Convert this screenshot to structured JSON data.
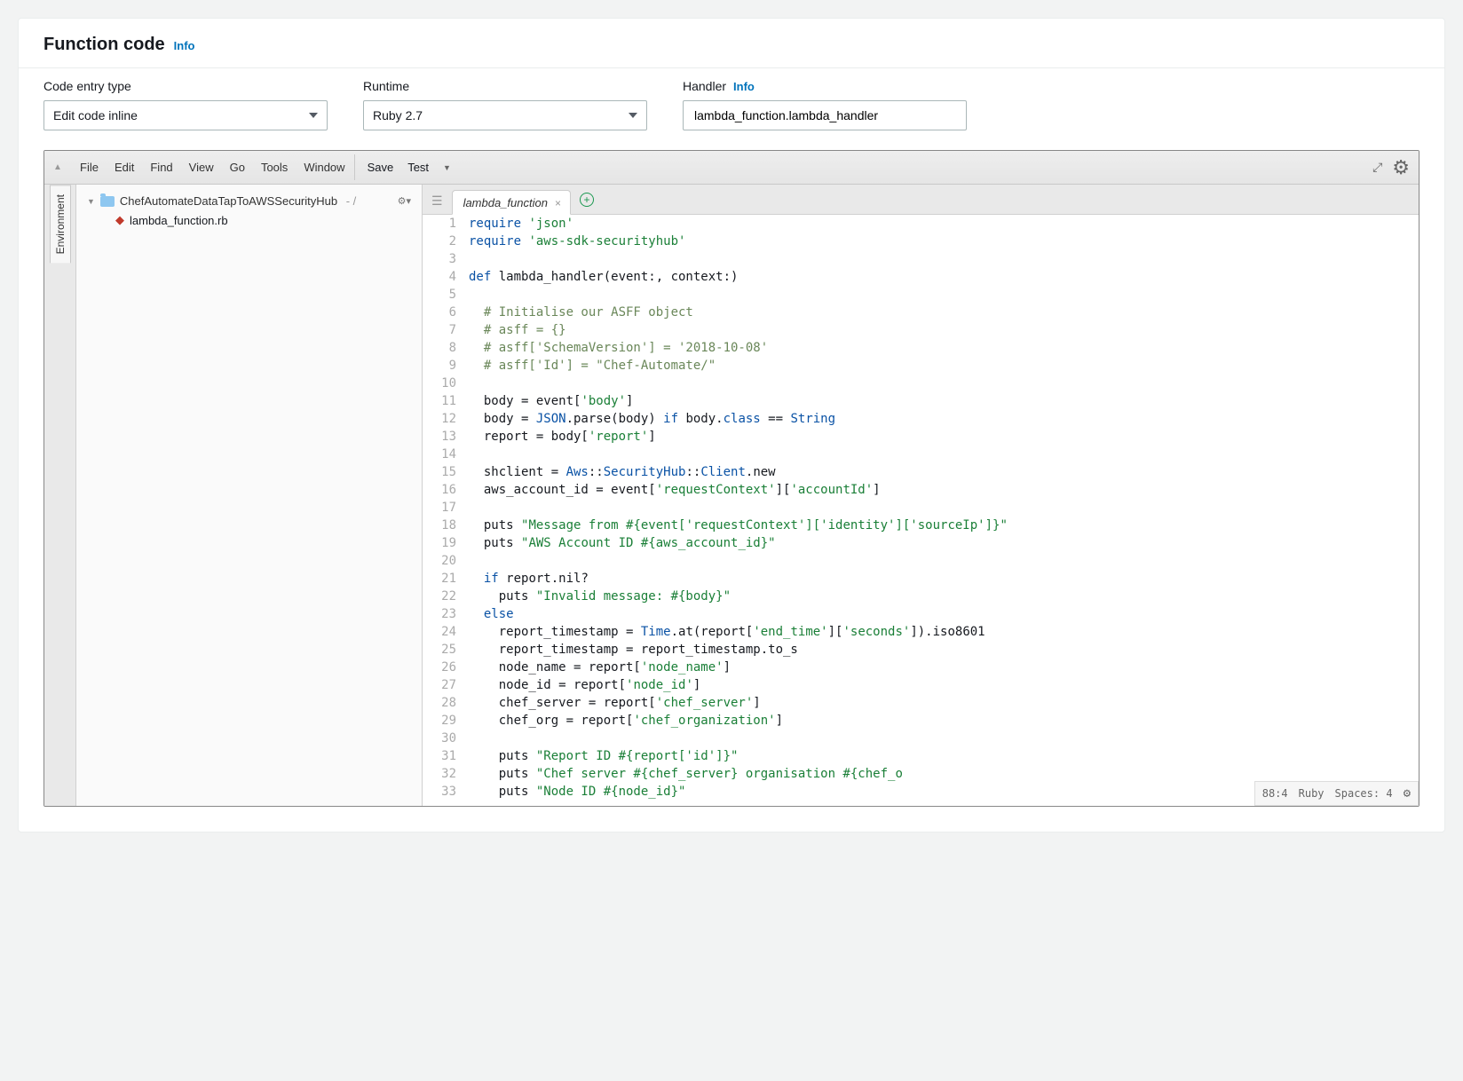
{
  "header": {
    "title": "Function code",
    "info": "Info"
  },
  "controls": {
    "codeEntry": {
      "label": "Code entry type",
      "value": "Edit code inline"
    },
    "runtime": {
      "label": "Runtime",
      "value": "Ruby 2.7"
    },
    "handler": {
      "label": "Handler",
      "info": "Info",
      "value": "lambda_function.lambda_handler"
    }
  },
  "ide": {
    "menus": [
      "File",
      "Edit",
      "Find",
      "View",
      "Go",
      "Tools",
      "Window"
    ],
    "actions": {
      "save": "Save",
      "test": "Test"
    },
    "sidebarTabLabel": "Environment",
    "tree": {
      "project": "ChefAutomateDataTapToAWSSecurityHub",
      "file": "lambda_function.rb"
    },
    "tab": "lambda_function",
    "statusBar": {
      "position": "88:4",
      "language": "Ruby",
      "spaces": "Spaces: 4"
    },
    "code": [
      {
        "n": 1,
        "tokens": [
          {
            "t": "require ",
            "c": "kw"
          },
          {
            "t": "'json'",
            "c": "str"
          }
        ]
      },
      {
        "n": 2,
        "tokens": [
          {
            "t": "require ",
            "c": "kw"
          },
          {
            "t": "'aws-sdk-securityhub'",
            "c": "str"
          }
        ]
      },
      {
        "n": 3,
        "tokens": [
          {
            "t": "",
            "c": ""
          }
        ]
      },
      {
        "n": 4,
        "tokens": [
          {
            "t": "def ",
            "c": "kw"
          },
          {
            "t": "lambda_handler(event:, context:)",
            "c": "fn"
          }
        ]
      },
      {
        "n": 5,
        "tokens": [
          {
            "t": "",
            "c": ""
          }
        ]
      },
      {
        "n": 6,
        "tokens": [
          {
            "t": "  # Initialise our ASFF object",
            "c": "com"
          }
        ]
      },
      {
        "n": 7,
        "tokens": [
          {
            "t": "  # asff = {}",
            "c": "com"
          }
        ]
      },
      {
        "n": 8,
        "tokens": [
          {
            "t": "  # asff['SchemaVersion'] = '2018-10-08'",
            "c": "com"
          }
        ]
      },
      {
        "n": 9,
        "tokens": [
          {
            "t": "  # asff['Id'] = \"Chef-Automate/\"",
            "c": "com"
          }
        ]
      },
      {
        "n": 10,
        "tokens": [
          {
            "t": "",
            "c": ""
          }
        ]
      },
      {
        "n": 11,
        "tokens": [
          {
            "t": "  body = event[",
            "c": ""
          },
          {
            "t": "'body'",
            "c": "str"
          },
          {
            "t": "]",
            "c": ""
          }
        ]
      },
      {
        "n": 12,
        "tokens": [
          {
            "t": "  body = ",
            "c": ""
          },
          {
            "t": "JSON",
            "c": "const"
          },
          {
            "t": ".parse(body) ",
            "c": ""
          },
          {
            "t": "if",
            "c": "kw"
          },
          {
            "t": " body.",
            "c": ""
          },
          {
            "t": "class",
            "c": "kw"
          },
          {
            "t": " == ",
            "c": ""
          },
          {
            "t": "String",
            "c": "const"
          }
        ]
      },
      {
        "n": 13,
        "tokens": [
          {
            "t": "  report = body[",
            "c": ""
          },
          {
            "t": "'report'",
            "c": "str"
          },
          {
            "t": "]",
            "c": ""
          }
        ]
      },
      {
        "n": 14,
        "tokens": [
          {
            "t": "",
            "c": ""
          }
        ]
      },
      {
        "n": 15,
        "tokens": [
          {
            "t": "  shclient = ",
            "c": ""
          },
          {
            "t": "Aws",
            "c": "const"
          },
          {
            "t": "::",
            "c": ""
          },
          {
            "t": "SecurityHub",
            "c": "const"
          },
          {
            "t": "::",
            "c": ""
          },
          {
            "t": "Client",
            "c": "const"
          },
          {
            "t": ".new",
            "c": ""
          }
        ]
      },
      {
        "n": 16,
        "tokens": [
          {
            "t": "  aws_account_id = event[",
            "c": ""
          },
          {
            "t": "'requestContext'",
            "c": "str"
          },
          {
            "t": "][",
            "c": ""
          },
          {
            "t": "'accountId'",
            "c": "str"
          },
          {
            "t": "]",
            "c": ""
          }
        ]
      },
      {
        "n": 17,
        "tokens": [
          {
            "t": "",
            "c": ""
          }
        ]
      },
      {
        "n": 18,
        "tokens": [
          {
            "t": "  puts ",
            "c": ""
          },
          {
            "t": "\"Message from #{event['requestContext']['identity']['sourceIp']}\"",
            "c": "str"
          }
        ]
      },
      {
        "n": 19,
        "tokens": [
          {
            "t": "  puts ",
            "c": ""
          },
          {
            "t": "\"AWS Account ID #{aws_account_id}\"",
            "c": "str"
          }
        ]
      },
      {
        "n": 20,
        "tokens": [
          {
            "t": "",
            "c": ""
          }
        ]
      },
      {
        "n": 21,
        "tokens": [
          {
            "t": "  if ",
            "c": "kw"
          },
          {
            "t": "report.nil?",
            "c": ""
          }
        ]
      },
      {
        "n": 22,
        "tokens": [
          {
            "t": "    puts ",
            "c": ""
          },
          {
            "t": "\"Invalid message: #{body}\"",
            "c": "str"
          }
        ]
      },
      {
        "n": 23,
        "tokens": [
          {
            "t": "  else",
            "c": "kw"
          }
        ]
      },
      {
        "n": 24,
        "tokens": [
          {
            "t": "    report_timestamp = ",
            "c": ""
          },
          {
            "t": "Time",
            "c": "const"
          },
          {
            "t": ".at(report[",
            "c": ""
          },
          {
            "t": "'end_time'",
            "c": "str"
          },
          {
            "t": "][",
            "c": ""
          },
          {
            "t": "'seconds'",
            "c": "str"
          },
          {
            "t": "]).iso8601",
            "c": ""
          }
        ]
      },
      {
        "n": 25,
        "tokens": [
          {
            "t": "    report_timestamp = report_timestamp.to_s",
            "c": ""
          }
        ]
      },
      {
        "n": 26,
        "tokens": [
          {
            "t": "    node_name = report[",
            "c": ""
          },
          {
            "t": "'node_name'",
            "c": "str"
          },
          {
            "t": "]",
            "c": ""
          }
        ]
      },
      {
        "n": 27,
        "tokens": [
          {
            "t": "    node_id = report[",
            "c": ""
          },
          {
            "t": "'node_id'",
            "c": "str"
          },
          {
            "t": "]",
            "c": ""
          }
        ]
      },
      {
        "n": 28,
        "tokens": [
          {
            "t": "    chef_server = report[",
            "c": ""
          },
          {
            "t": "'chef_server'",
            "c": "str"
          },
          {
            "t": "]",
            "c": ""
          }
        ]
      },
      {
        "n": 29,
        "tokens": [
          {
            "t": "    chef_org = report[",
            "c": ""
          },
          {
            "t": "'chef_organization'",
            "c": "str"
          },
          {
            "t": "]",
            "c": ""
          }
        ]
      },
      {
        "n": 30,
        "tokens": [
          {
            "t": "",
            "c": ""
          }
        ]
      },
      {
        "n": 31,
        "tokens": [
          {
            "t": "    puts ",
            "c": ""
          },
          {
            "t": "\"Report ID #{report['id']}\"",
            "c": "str"
          }
        ]
      },
      {
        "n": 32,
        "tokens": [
          {
            "t": "    puts ",
            "c": ""
          },
          {
            "t": "\"Chef server #{chef_server} organisation #{chef_o",
            "c": "str"
          }
        ]
      },
      {
        "n": 33,
        "tokens": [
          {
            "t": "    puts ",
            "c": ""
          },
          {
            "t": "\"Node ID #{node_id}\"",
            "c": "str"
          }
        ]
      }
    ]
  }
}
